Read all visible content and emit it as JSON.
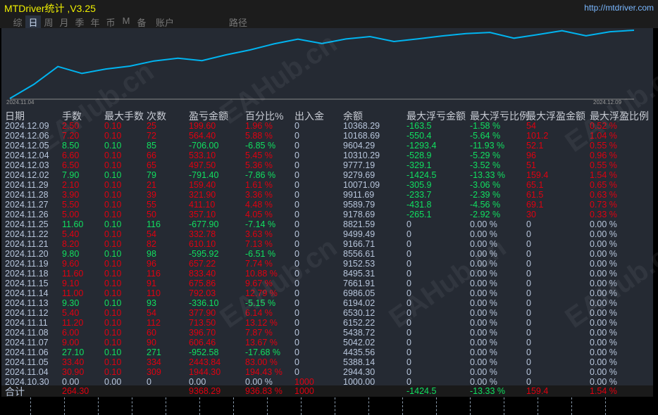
{
  "app": {
    "title": "MTDriver统计 ,V3.25",
    "url": "http://mtdriver.com"
  },
  "tabs": [
    {
      "label": "综",
      "active": false
    },
    {
      "label": "日",
      "active": true
    },
    {
      "label": "周",
      "active": false
    },
    {
      "label": "月",
      "active": false
    },
    {
      "label": "季",
      "active": false
    },
    {
      "label": "年",
      "active": false
    },
    {
      "label": "币",
      "active": false
    },
    {
      "label": "M",
      "active": false
    },
    {
      "label": "备",
      "active": false
    },
    {
      "label": "账户",
      "active": false
    },
    {
      "label": "路径",
      "active": false
    }
  ],
  "chart": {
    "start_label": "2024.11.04",
    "end_label": "2024.12.09",
    "line_color": "#00b4f0"
  },
  "columns": [
    "日期",
    "手数",
    "最大手数",
    "次数",
    "盈亏金额",
    "百分比%",
    "出入金",
    "余额",
    "最大浮亏金额",
    "最大浮亏比例",
    "最大浮盈金额",
    "最大浮盈比例"
  ],
  "rows": [
    [
      "2024.12.09",
      "2.50",
      "0.10",
      "25",
      "199.60",
      "1.96 %",
      "0",
      "10368.29",
      "-163.5",
      "-1.58 %",
      "54",
      "0.52 %"
    ],
    [
      "2024.12.06",
      "7.20",
      "0.10",
      "72",
      "564.40",
      "5.88 %",
      "0",
      "10168.69",
      "-550.4",
      "-5.64 %",
      "101.2",
      "1.04 %"
    ],
    [
      "2024.12.05",
      "8.50",
      "0.10",
      "85",
      "-706.00",
      "-6.85 %",
      "0",
      "9604.29",
      "-1293.4",
      "-11.93 %",
      "52.1",
      "0.55 %"
    ],
    [
      "2024.12.04",
      "6.60",
      "0.10",
      "66",
      "533.10",
      "5.45 %",
      "0",
      "10310.29",
      "-528.9",
      "-5.29 %",
      "96",
      "0.96 %"
    ],
    [
      "2024.12.03",
      "6.50",
      "0.10",
      "65",
      "497.50",
      "5.36 %",
      "0",
      "9777.19",
      "-329.1",
      "-3.52 %",
      "51",
      "0.55 %"
    ],
    [
      "2024.12.02",
      "7.90",
      "0.10",
      "79",
      "-791.40",
      "-7.86 %",
      "0",
      "9279.69",
      "-1424.5",
      "-13.33 %",
      "159.4",
      "1.54 %"
    ],
    [
      "2024.11.29",
      "2.10",
      "0.10",
      "21",
      "159.40",
      "1.61 %",
      "0",
      "10071.09",
      "-305.9",
      "-3.06 %",
      "65.1",
      "0.65 %"
    ],
    [
      "2024.11.28",
      "3.90",
      "0.10",
      "39",
      "321.90",
      "3.36 %",
      "0",
      "9911.69",
      "-233.7",
      "-2.39 %",
      "61.5",
      "0.63 %"
    ],
    [
      "2024.11.27",
      "5.50",
      "0.10",
      "55",
      "411.10",
      "4.48 %",
      "0",
      "9589.79",
      "-431.8",
      "-4.56 %",
      "69.1",
      "0.73 %"
    ],
    [
      "2024.11.26",
      "5.00",
      "0.10",
      "50",
      "357.10",
      "4.05 %",
      "0",
      "9178.69",
      "-265.1",
      "-2.92 %",
      "30",
      "0.33 %"
    ],
    [
      "2024.11.25",
      "11.60",
      "0.10",
      "116",
      "-677.90",
      "-7.14 %",
      "0",
      "8821.59",
      "0",
      "0.00 %",
      "0",
      "0.00 %"
    ],
    [
      "2024.11.22",
      "5.40",
      "0.10",
      "54",
      "332.78",
      "3.63 %",
      "0",
      "9499.49",
      "0",
      "0.00 %",
      "0",
      "0.00 %"
    ],
    [
      "2024.11.21",
      "8.20",
      "0.10",
      "82",
      "610.10",
      "7.13 %",
      "0",
      "9166.71",
      "0",
      "0.00 %",
      "0",
      "0.00 %"
    ],
    [
      "2024.11.20",
      "9.80",
      "0.10",
      "98",
      "-595.92",
      "-6.51 %",
      "0",
      "8556.61",
      "0",
      "0.00 %",
      "0",
      "0.00 %"
    ],
    [
      "2024.11.19",
      "9.60",
      "0.10",
      "96",
      "657.22",
      "7.74 %",
      "0",
      "9152.53",
      "0",
      "0.00 %",
      "0",
      "0.00 %"
    ],
    [
      "2024.11.18",
      "11.60",
      "0.10",
      "116",
      "833.40",
      "10.88 %",
      "0",
      "8495.31",
      "0",
      "0.00 %",
      "0",
      "0.00 %"
    ],
    [
      "2024.11.15",
      "9.10",
      "0.10",
      "91",
      "675.86",
      "9.67 %",
      "0",
      "7661.91",
      "0",
      "0.00 %",
      "0",
      "0.00 %"
    ],
    [
      "2024.11.14",
      "11.00",
      "0.10",
      "110",
      "792.03",
      "12.79 %",
      "0",
      "6986.05",
      "0",
      "0.00 %",
      "0",
      "0.00 %"
    ],
    [
      "2024.11.13",
      "9.30",
      "0.10",
      "93",
      "-336.10",
      "-5.15 %",
      "0",
      "6194.02",
      "0",
      "0.00 %",
      "0",
      "0.00 %"
    ],
    [
      "2024.11.12",
      "5.40",
      "0.10",
      "54",
      "377.90",
      "6.14 %",
      "0",
      "6530.12",
      "0",
      "0.00 %",
      "0",
      "0.00 %"
    ],
    [
      "2024.11.11",
      "11.20",
      "0.10",
      "112",
      "713.50",
      "13.12 %",
      "0",
      "6152.22",
      "0",
      "0.00 %",
      "0",
      "0.00 %"
    ],
    [
      "2024.11.08",
      "6.00",
      "0.10",
      "60",
      "396.70",
      "7.87 %",
      "0",
      "5438.72",
      "0",
      "0.00 %",
      "0",
      "0.00 %"
    ],
    [
      "2024.11.07",
      "9.00",
      "0.10",
      "90",
      "606.46",
      "13.67 %",
      "0",
      "5042.02",
      "0",
      "0.00 %",
      "0",
      "0.00 %"
    ],
    [
      "2024.11.06",
      "27.10",
      "0.10",
      "271",
      "-952.58",
      "-17.68 %",
      "0",
      "4435.56",
      "0",
      "0.00 %",
      "0",
      "0.00 %"
    ],
    [
      "2024.11.05",
      "33.40",
      "0.10",
      "334",
      "2443.84",
      "83.00 %",
      "0",
      "5388.14",
      "0",
      "0.00 %",
      "0",
      "0.00 %"
    ],
    [
      "2024.11.04",
      "30.90",
      "0.10",
      "309",
      "1944.30",
      "194.43 %",
      "0",
      "2944.30",
      "0",
      "0.00 %",
      "0",
      "0.00 %"
    ],
    [
      "2024.10.30",
      "0.00",
      "0.00",
      "0",
      "0.00",
      "0.00 %",
      "1000",
      "1000.00",
      "0",
      "0.00 %",
      "0",
      "0.00 %"
    ]
  ],
  "totals": {
    "label": "合计",
    "lots": "264.30",
    "profit": "9368.29",
    "percent": "936.83 %",
    "deposit": "1000",
    "max_float_loss": "-1424.5",
    "max_float_loss_pct": "-13.33 %",
    "max_float_profit": "159.4",
    "max_float_profit_pct": "1.54 %"
  },
  "watermark": "EAHub.cn",
  "colors": {
    "profit": "#e00010",
    "loss": "#10e060",
    "neutral": "#b8c6dc"
  }
}
